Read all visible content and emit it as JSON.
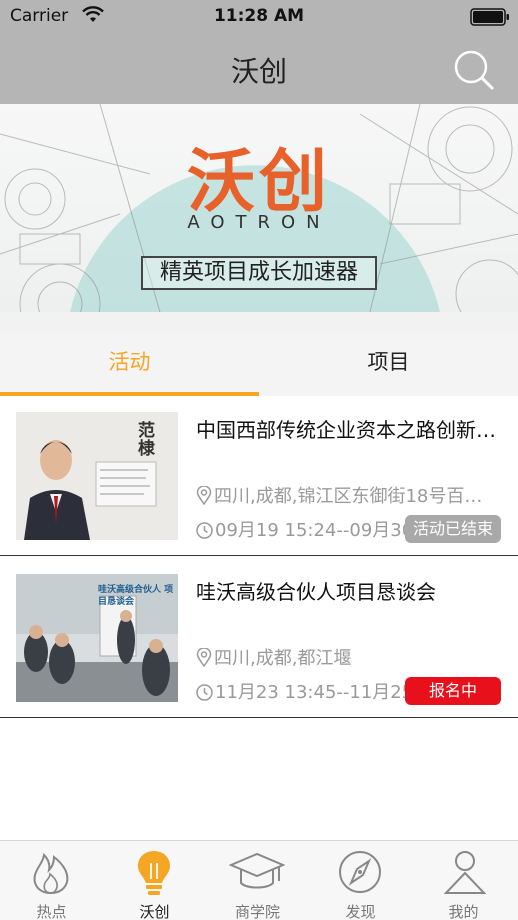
{
  "status_bar": {
    "carrier": "Carrier",
    "time": "11:28 AM"
  },
  "nav": {
    "title": "沃创"
  },
  "banner": {
    "logo": "沃创",
    "subtitle": "AOTRON",
    "slogan": "精英项目成长加速器"
  },
  "tabs": [
    {
      "label": "活动",
      "active": true
    },
    {
      "label": "项目",
      "active": false
    }
  ],
  "activities": [
    {
      "title": "中国西部传统企业资本之路创新…",
      "location": "四川,成都,锦江区东御街18号百…",
      "time": "09月19 15:24--09月30",
      "status": "活动已结束",
      "status_color": "#a8a8a8",
      "thumb_text": "范棣"
    },
    {
      "title": "哇沃高级合伙人项目恳谈会",
      "location": "四川,成都,都江堰",
      "time": "11月23 13:45--11月25",
      "status": "报名中",
      "status_color": "#e8111b",
      "thumb_text": "哇沃高级合伙人 项目恳谈会"
    }
  ],
  "tab_bar": [
    {
      "label": "热点",
      "icon": "flame-icon",
      "active": false
    },
    {
      "label": "沃创",
      "icon": "lightbulb-icon",
      "active": true
    },
    {
      "label": "商学院",
      "icon": "graduation-cap-icon",
      "active": false
    },
    {
      "label": "发现",
      "icon": "compass-icon",
      "active": false
    },
    {
      "label": "我的",
      "icon": "person-icon",
      "active": false
    }
  ],
  "colors": {
    "accent": "#f5a623",
    "nav_bg": "#b5b5b5",
    "open_badge": "#e8111b",
    "ended_badge": "#a8a8a8"
  }
}
